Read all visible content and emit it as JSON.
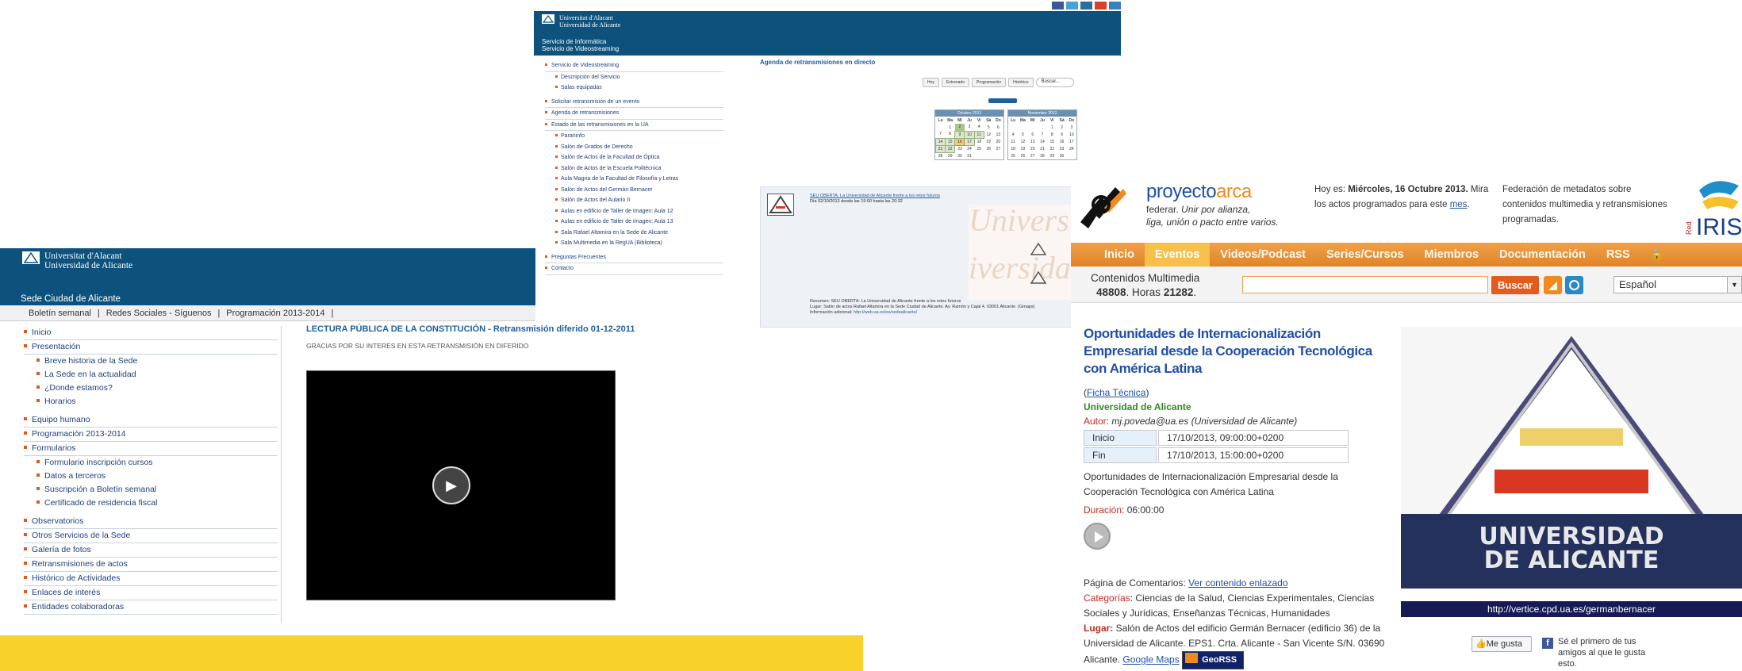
{
  "sede": {
    "logo_line1": "Universitat d'Alacant",
    "logo_line2": "Universidad de Alicante",
    "site_name": "Sede Ciudad de Alicante",
    "nav": [
      "Boletín semanal",
      "|",
      "Redes Sociales - Síguenos",
      "|",
      "Programación 2013-2014",
      "|"
    ],
    "menu": [
      {
        "label": "Inicio",
        "level": 0
      },
      {
        "label": "Presentación",
        "level": 0
      },
      {
        "label": "Breve historia de la Sede",
        "level": 1
      },
      {
        "label": "La Sede en la actualidad",
        "level": 1
      },
      {
        "label": "¿Donde estamos?",
        "level": 1
      },
      {
        "label": "Horarios",
        "level": 1
      },
      {
        "label": "Equipo humano",
        "level": 0
      },
      {
        "label": "Programación 2013-2014",
        "level": 0
      },
      {
        "label": "Formularios",
        "level": 0
      },
      {
        "label": "Formulario inscripción cursos",
        "level": 1
      },
      {
        "label": "Datos a terceros",
        "level": 1
      },
      {
        "label": "Suscripción a Boletín semanal",
        "level": 1
      },
      {
        "label": "Certificado de residencia fiscal",
        "level": 1
      },
      {
        "label": "Observatorios",
        "level": 0
      },
      {
        "label": "Otros Servicios de la Sede",
        "level": 0
      },
      {
        "label": "Galería de fotos",
        "level": 0
      },
      {
        "label": "Retransmisiones de actos",
        "level": 0
      },
      {
        "label": "Histórico de Actividades",
        "level": 0
      },
      {
        "label": "Enlaces de interés",
        "level": 0
      },
      {
        "label": "Entidades colaboradoras",
        "level": 0
      }
    ],
    "title": "LECTURA PÚBLICA DE LA CONSTITUCIÓN - Retransmisión diferido 01-12-2011",
    "thanks": "GRACIAS POR SU INTERES EN ESTA RETRANSMISIÓN EN DIFERIDO",
    "play_icon": "play-icon"
  },
  "video": {
    "logo_line1": "Universitat d'Alacant",
    "logo_line2": "Universidad de Alicante",
    "service1": "Servicio de Informática",
    "service2": "Servicio de Videostreaming",
    "menu": [
      {
        "label": "Servicio de Videostreaming",
        "level": 0
      },
      {
        "label": "Descripción del Servicio",
        "level": 1
      },
      {
        "label": "Salas equipadas",
        "level": 1
      },
      {
        "label": "Solicitar retransmisión de un evento",
        "level": 0
      },
      {
        "label": "Agenda de retransmisiones",
        "level": 0
      },
      {
        "label": "Estado de las retransmisiones en la UA",
        "level": 0
      },
      {
        "label": "Paraninfo",
        "level": 1
      },
      {
        "label": "Salón de Grados de Derecho",
        "level": 1
      },
      {
        "label": "Salón de Actos de la Facultad de Óptica",
        "level": 1
      },
      {
        "label": "Salón de Actos de la Escuela Politécnica",
        "level": 1
      },
      {
        "label": "Aula Magna de la Facultad de Filosofía y Letras",
        "level": 1
      },
      {
        "label": "Salón de Actos del Germán Bernacer",
        "level": 1
      },
      {
        "label": "Salón de Actos del Aulario II",
        "level": 1
      },
      {
        "label": "Aulas en edificio de Taller de Imagen: Aula 12",
        "level": 1
      },
      {
        "label": "Aulas en edificio de Taller de Imagen: Aula 13",
        "level": 1
      },
      {
        "label": "Sala Rafael Altamira en la Sede de Alicante",
        "level": 1
      },
      {
        "label": "Sala Multimedia en la RegUA (Biblioteca)",
        "level": 1
      },
      {
        "label": "Preguntas Frecuentes",
        "level": 0
      },
      {
        "label": "Contacto",
        "level": 0
      }
    ],
    "heading": "Agenda de retransmisiones en directo",
    "buttons": [
      "Hoy",
      "Entrenado",
      "Programación",
      "Histórico"
    ],
    "search_placeholder": "Buscar...",
    "cal1_title": "Octubre 2013",
    "cal2_title": "Noviembre 2013",
    "weekdays": [
      "Lu",
      "Ma",
      "Mi",
      "Ju",
      "Vi",
      "Sá",
      "Do"
    ],
    "event_title": "SEU OBERTA: La Universidad de Alicante frente a los retos futuros",
    "event_date": "Día 02/10/2013 desde las 19:00 hasta las 20:32",
    "resumen": "Resumen: SEU OBERTA: La Universidad de Alicante frente a los retos futuros",
    "lugar": "Lugar: Salón de actos Rafael Altamira en la Sede Ciudad de Alicante. Av. Ramón y Cajal 4. 03001 Alicante. (Gmaps)",
    "info_label": "Información adicional:",
    "info_link": "http://web.ua.es/es/sedealicante/"
  },
  "arca": {
    "brand1": "proyecto",
    "brand2": "arca",
    "tag1": "federar.",
    "tag2": " Unir por alianza,",
    "tag3": "liga, unión o pacto entre varios.",
    "hoy_prefix": "Hoy es: ",
    "hoy_date": "Miércoles, 16 Octubre 2013.",
    "hoy_rest": "Mira los actos programados para este ",
    "hoy_link": "mes",
    "fed": "Federación de metadatos sobre contenidos multimedia y retransmisiones programadas.",
    "rediris": "Red IRIS",
    "menu": [
      "Inicio",
      "Eventos",
      "Videos/Podcast",
      "Series/Cursos",
      "Miembros",
      "Documentación",
      "RSS"
    ],
    "active_menu": "Eventos",
    "cm_label": "Contenidos Multimedia",
    "cm_count": "48808",
    "cm_hours_label": ". Horas ",
    "cm_hours": "21282",
    "search_button": "Buscar",
    "language": "Español",
    "event_title": "Oportunidades de Internacionalización Empresarial desde la Cooperación Tecnológica con América Latina",
    "ficha": "Ficha Técnica",
    "org": "Universidad de Alicante",
    "autor_label": "Autor",
    "autor_value": "mj.poveda@ua.es (Universidad de Alicante)",
    "inicio_label": "Inicio",
    "inicio_value": "17/10/2013, 09:00:00+0200",
    "fin_label": "Fin",
    "fin_value": "17/10/2013, 15:00:00+0200",
    "desc": "Oportunidades de Internacionalización Empresarial desde la Cooperación Tecnológica con América Latina",
    "duracion_label": "Duración",
    "duracion_value": "06:00:00",
    "comentarios_label": "Página de Comentarios",
    "comentarios_link": "Ver contenido enlazado",
    "categorias_label": "Categorías",
    "categorias_value": "Ciencias de la Salud, Ciencias Experimentales, Ciencias Sociales y Jurídicas, Enseñanzas Técnicas, Humanidades",
    "lugar_label": "Lugar:",
    "lugar_value": " Salón de Actos del edificio Germán Bernacer (edificio 36) de la Universidad de Alicante. EPS1. Crta. Alicante - San Vicente S/N. 03690 Alicante. ",
    "gmaps": "Google Maps",
    "georss": "GeoRSS",
    "img_text1": "UNIVERSIDAD",
    "img_text2": "DE ALICANTE",
    "url": "http://vertice.cpd.ua.es/germanbernacer",
    "like": "Me gusta",
    "fb_text": "Sé el primero de tus amigos al que le gusta esto."
  }
}
